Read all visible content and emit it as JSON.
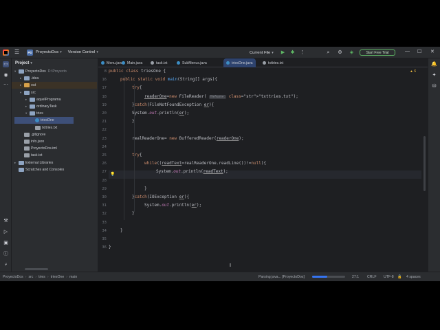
{
  "titlebar": {
    "project_badge": "PD",
    "project_name": "ProyectoDos",
    "version_control": "Version Control",
    "run_config": "Current File",
    "trial_button": "Start Free Trial"
  },
  "project_panel": {
    "title": "Project",
    "tree": [
      {
        "label": "ProyectoDos",
        "extra": "D:\\Proyecto",
        "depth": 0,
        "icon": "fold",
        "arrow": "v"
      },
      {
        "label": ".idea",
        "depth": 1,
        "icon": "fold",
        "arrow": ">"
      },
      {
        "label": "out",
        "depth": 1,
        "icon": "fold-o",
        "arrow": ">"
      },
      {
        "label": "src",
        "depth": 1,
        "icon": "fold",
        "arrow": "v"
      },
      {
        "label": "aquelPrograma",
        "depth": 2,
        "icon": "fold",
        "arrow": ">"
      },
      {
        "label": "ordinaryTask",
        "depth": 2,
        "icon": "fold",
        "arrow": ">"
      },
      {
        "label": "tries",
        "depth": 2,
        "icon": "fold",
        "arrow": "v"
      },
      {
        "label": "triesOne",
        "depth": 3,
        "icon": "jcls",
        "arrow": "",
        "selected": true
      },
      {
        "label": "txttries.txt",
        "depth": 3,
        "icon": "file",
        "arrow": ""
      },
      {
        "label": ".gitignore",
        "depth": 1,
        "icon": "file",
        "arrow": ""
      },
      {
        "label": "info.json",
        "depth": 1,
        "icon": "file",
        "arrow": ""
      },
      {
        "label": "ProyectoDos.iml",
        "depth": 1,
        "icon": "file",
        "arrow": ""
      },
      {
        "label": "task.txt",
        "depth": 1,
        "icon": "file",
        "arrow": ""
      },
      {
        "label": "External Libraries",
        "depth": 0,
        "icon": "fold",
        "arrow": ">"
      },
      {
        "label": "Scratches and Consoles",
        "depth": 0,
        "icon": "fold",
        "arrow": ""
      }
    ]
  },
  "tabs": [
    "Menu.java",
    "Main.java",
    "task.txt",
    "SubMenus.java",
    "triesOne.java",
    "txttries.txt"
  ],
  "active_tab": "triesOne.java",
  "editor": {
    "warning_count": "6",
    "line_numbers": [
      "8",
      "16",
      "17",
      "18",
      "19",
      "20",
      "21",
      "22",
      "23",
      "24",
      "25",
      "26",
      "27",
      "28",
      "29",
      "30",
      "31",
      "32",
      "33",
      "34",
      "35",
      "36"
    ],
    "lines": [
      "public class triesOne {",
      "public static void main(String[] args){",
      "try{",
      "readerOne=new FileReader( fileName: \"txttries.txt\");",
      "}catch(FileNotFoundException er){",
      "System.out.println(er);",
      "}",
      "",
      "realReaderOne= new BufferedReader(readerOne);",
      "",
      "try{",
      "while((readText=realReaderOne.readLine())!=null){",
      "System.out.println(readText);",
      "",
      "}",
      "}catch(IOException er){",
      "System.out.println(er);",
      "}",
      "",
      "}",
      "",
      "}"
    ],
    "param_hint": "fileName:"
  },
  "statusbar": {
    "breadcrumb": [
      "ProyectoDos",
      "src",
      "tries",
      "triesOne",
      "main"
    ],
    "task": "Parsing java... [ProyectoDos]",
    "progress": 0.45,
    "position": "27:1",
    "line_sep": "CRLF",
    "encoding": "UTF-8",
    "indent": "4 spaces"
  }
}
